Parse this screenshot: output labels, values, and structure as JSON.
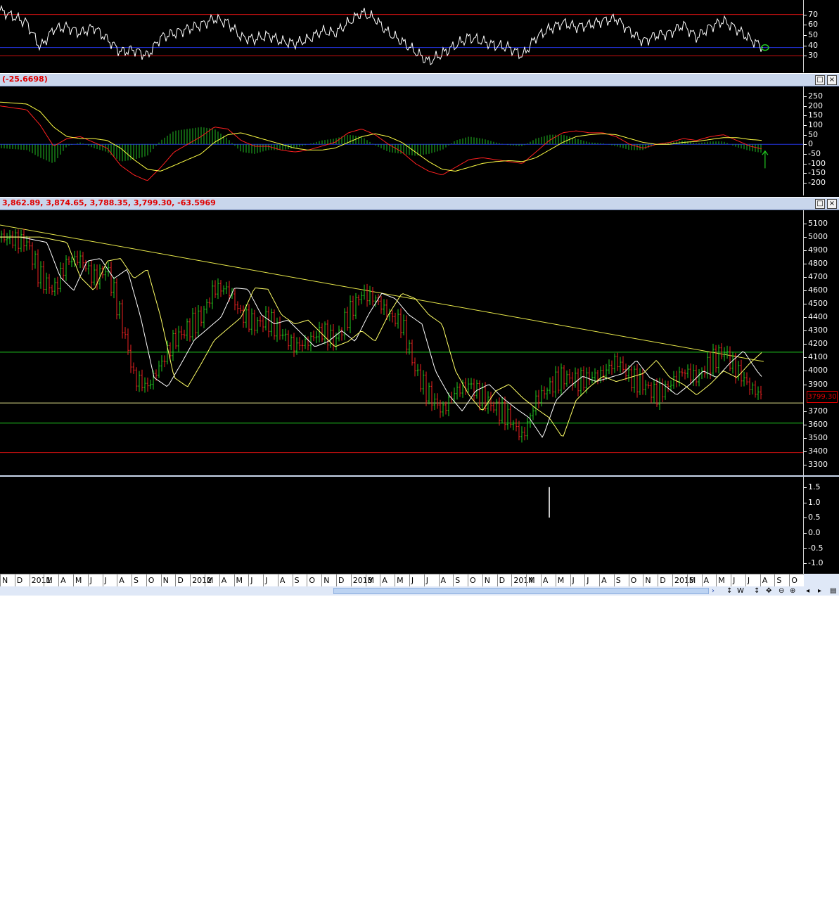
{
  "panes": {
    "rsi": {
      "axis_ticks": [
        "70",
        "60",
        "50",
        "40",
        "30"
      ],
      "tick_values": [
        70,
        60,
        50,
        40,
        30
      ],
      "ylim": [
        18,
        80
      ]
    },
    "macd": {
      "readout": "(-25.6698)",
      "axis_ticks": [
        "250",
        "200",
        "150",
        "100",
        "50",
        "0",
        "-50",
        "-100",
        "-150",
        "-200"
      ],
      "tick_values": [
        250,
        200,
        150,
        100,
        50,
        0,
        -50,
        -100,
        -150,
        -200
      ]
    },
    "price": {
      "readout": "3,862.89, 3,874.65, 3,788.35, 3,799.30, -63.5969",
      "last_price": "3799.30",
      "axis_ticks": [
        "5100",
        "5000",
        "4900",
        "4800",
        "4700",
        "4600",
        "4500",
        "4400",
        "4300",
        "4200",
        "4100",
        "4000",
        "3900",
        "3700",
        "3600",
        "3500",
        "3400",
        "3300"
      ],
      "tick_values": [
        5100,
        5000,
        4900,
        4800,
        4700,
        4600,
        4500,
        4400,
        4300,
        4200,
        4100,
        4000,
        3900,
        3700,
        3600,
        3500,
        3400,
        3300
      ]
    },
    "volume": {
      "axis_ticks": [
        "1.5",
        "1.0",
        "0.5",
        "0.0",
        "-0.5",
        "-1.0"
      ],
      "tick_values": [
        1.5,
        1.0,
        0.5,
        0.0,
        -0.5,
        -1.0
      ]
    }
  },
  "time_axis": [
    "N",
    "D",
    "2011",
    "M",
    "A",
    "M",
    "J",
    "J",
    "A",
    "S",
    "O",
    "N",
    "D",
    "2012",
    "M",
    "A",
    "M",
    "J",
    "J",
    "A",
    "S",
    "O",
    "N",
    "D",
    "2013",
    "M",
    "A",
    "M",
    "J",
    "J",
    "A",
    "S",
    "O",
    "N",
    "D",
    "2014",
    "M",
    "A",
    "M",
    "J",
    "J",
    "A",
    "S",
    "O",
    "N",
    "D",
    "2015",
    "M",
    "A",
    "M",
    "J",
    "J",
    "A",
    "S",
    "O"
  ],
  "controls": [
    "W",
    "↕",
    "✥",
    "⊖",
    "⊕",
    "◂",
    "▸",
    "▤"
  ],
  "window_buttons": {
    "restore": "□",
    "close": "×"
  },
  "colors": {
    "up": "#22cc22",
    "down": "#ee2222",
    "trend": "#e8e84a",
    "ma_fast": "#ffffff",
    "ma_slow": "#ffff66",
    "rsi": "#ffffff",
    "macd": "#ff2020",
    "signal": "#ffff44",
    "hist": "#22bb22",
    "level_red": "#cc1111",
    "level_blue": "#2233dd",
    "level_green": "#22cc22"
  },
  "chart_data": {
    "type": "candlestick",
    "title": "",
    "x_range": [
      "2010-11",
      "2015-10"
    ],
    "price_levels": {
      "resistance": 4140,
      "support_1": 3760,
      "support_2": 3610,
      "support_3": 3390
    },
    "trendline": {
      "from": [
        "2010-11",
        5090
      ],
      "to": [
        "2015-08",
        4070
      ]
    },
    "close_path": [
      [
        "2010-11",
        5000
      ],
      [
        "2011-01",
        4960
      ],
      [
        "2011-02",
        4700
      ],
      [
        "2011-03",
        4600
      ],
      [
        "2011-04",
        4820
      ],
      [
        "2011-05",
        4840
      ],
      [
        "2011-06",
        4690
      ],
      [
        "2011-07",
        4760
      ],
      [
        "2011-08",
        4400
      ],
      [
        "2011-09",
        3950
      ],
      [
        "2011-10",
        3880
      ],
      [
        "2011-11",
        4050
      ],
      [
        "2011-12",
        4230
      ],
      [
        "2012-02",
        4400
      ],
      [
        "2012-03",
        4620
      ],
      [
        "2012-04",
        4610
      ],
      [
        "2012-05",
        4420
      ],
      [
        "2012-06",
        4350
      ],
      [
        "2012-07",
        4380
      ],
      [
        "2012-08",
        4280
      ],
      [
        "2012-09",
        4180
      ],
      [
        "2012-10",
        4220
      ],
      [
        "2012-11",
        4300
      ],
      [
        "2012-12",
        4220
      ],
      [
        "2013-01",
        4420
      ],
      [
        "2013-02",
        4580
      ],
      [
        "2013-03",
        4540
      ],
      [
        "2013-04",
        4420
      ],
      [
        "2013-05",
        4350
      ],
      [
        "2013-06",
        4000
      ],
      [
        "2013-07",
        3820
      ],
      [
        "2013-08",
        3700
      ],
      [
        "2013-09",
        3850
      ],
      [
        "2013-10",
        3900
      ],
      [
        "2013-11",
        3800
      ],
      [
        "2013-12",
        3720
      ],
      [
        "2014-01",
        3650
      ],
      [
        "2014-02",
        3500
      ],
      [
        "2014-03",
        3780
      ],
      [
        "2014-04",
        3880
      ],
      [
        "2014-05",
        3960
      ],
      [
        "2014-06",
        3920
      ],
      [
        "2014-07",
        3950
      ],
      [
        "2014-08",
        3980
      ],
      [
        "2014-09",
        4080
      ],
      [
        "2014-10",
        3950
      ],
      [
        "2014-11",
        3900
      ],
      [
        "2014-12",
        3820
      ],
      [
        "2015-01",
        3900
      ],
      [
        "2015-02",
        4000
      ],
      [
        "2015-03",
        3950
      ],
      [
        "2015-04",
        4060
      ],
      [
        "2015-05",
        4150
      ],
      [
        "2015-06",
        4000
      ],
      [
        "2015-07",
        3880
      ],
      [
        "2015-08",
        3799.3
      ]
    ],
    "last_bar": {
      "open": 3862.89,
      "high": 3874.65,
      "low": 3788.35,
      "close": 3799.3,
      "change": -63.5969
    },
    "rsi": [
      [
        "2010-11",
        74
      ],
      [
        "2011-01",
        62
      ],
      [
        "2011-02",
        38
      ],
      [
        "2011-03",
        56
      ],
      [
        "2011-04",
        58
      ],
      [
        "2011-05",
        52
      ],
      [
        "2011-06",
        58
      ],
      [
        "2011-07",
        46
      ],
      [
        "2011-08",
        34
      ],
      [
        "2011-09",
        36
      ],
      [
        "2011-10",
        30
      ],
      [
        "2011-11",
        48
      ],
      [
        "2011-12",
        52
      ],
      [
        "2012-02",
        60
      ],
      [
        "2012-03",
        66
      ],
      [
        "2012-04",
        62
      ],
      [
        "2012-05",
        48
      ],
      [
        "2012-06",
        46
      ],
      [
        "2012-07",
        50
      ],
      [
        "2012-08",
        44
      ],
      [
        "2012-09",
        42
      ],
      [
        "2012-10",
        46
      ],
      [
        "2012-11",
        54
      ],
      [
        "2012-12",
        52
      ],
      [
        "2013-01",
        62
      ],
      [
        "2013-02",
        72
      ],
      [
        "2013-03",
        66
      ],
      [
        "2013-04",
        52
      ],
      [
        "2013-05",
        44
      ],
      [
        "2013-06",
        34
      ],
      [
        "2013-07",
        24
      ],
      [
        "2013-08",
        32
      ],
      [
        "2013-09",
        40
      ],
      [
        "2013-10",
        48
      ],
      [
        "2013-11",
        44
      ],
      [
        "2013-12",
        40
      ],
      [
        "2014-01",
        38
      ],
      [
        "2014-02",
        30
      ],
      [
        "2014-03",
        48
      ],
      [
        "2014-04",
        56
      ],
      [
        "2014-05",
        62
      ],
      [
        "2014-06",
        58
      ],
      [
        "2014-07",
        60
      ],
      [
        "2014-08",
        64
      ],
      [
        "2014-09",
        66
      ],
      [
        "2014-10",
        54
      ],
      [
        "2014-11",
        44
      ],
      [
        "2014-12",
        50
      ],
      [
        "2015-01",
        52
      ],
      [
        "2015-02",
        60
      ],
      [
        "2015-03",
        48
      ],
      [
        "2015-04",
        58
      ],
      [
        "2015-05",
        64
      ],
      [
        "2015-06",
        56
      ],
      [
        "2015-07",
        46
      ],
      [
        "2015-08",
        38
      ]
    ],
    "macd": [
      [
        "2010-11",
        200
      ],
      [
        "2011-01",
        180
      ],
      [
        "2011-02",
        100
      ],
      [
        "2011-03",
        -10
      ],
      [
        "2011-04",
        30
      ],
      [
        "2011-05",
        40
      ],
      [
        "2011-06",
        10
      ],
      [
        "2011-07",
        -20
      ],
      [
        "2011-08",
        -110
      ],
      [
        "2011-09",
        -160
      ],
      [
        "2011-10",
        -190
      ],
      [
        "2011-11",
        -120
      ],
      [
        "2011-12",
        -40
      ],
      [
        "2012-02",
        40
      ],
      [
        "2012-03",
        90
      ],
      [
        "2012-04",
        80
      ],
      [
        "2012-05",
        20
      ],
      [
        "2012-06",
        -10
      ],
      [
        "2012-07",
        -10
      ],
      [
        "2012-08",
        -30
      ],
      [
        "2012-09",
        -40
      ],
      [
        "2012-10",
        -30
      ],
      [
        "2012-11",
        -10
      ],
      [
        "2012-12",
        10
      ],
      [
        "2013-01",
        60
      ],
      [
        "2013-02",
        80
      ],
      [
        "2013-03",
        50
      ],
      [
        "2013-04",
        0
      ],
      [
        "2013-05",
        -40
      ],
      [
        "2013-06",
        -100
      ],
      [
        "2013-07",
        -140
      ],
      [
        "2013-08",
        -160
      ],
      [
        "2013-09",
        -120
      ],
      [
        "2013-10",
        -80
      ],
      [
        "2013-11",
        -70
      ],
      [
        "2013-12",
        -80
      ],
      [
        "2014-01",
        -90
      ],
      [
        "2014-02",
        -100
      ],
      [
        "2014-03",
        -40
      ],
      [
        "2014-04",
        20
      ],
      [
        "2014-05",
        60
      ],
      [
        "2014-06",
        70
      ],
      [
        "2014-07",
        60
      ],
      [
        "2014-08",
        60
      ],
      [
        "2014-09",
        40
      ],
      [
        "2014-10",
        0
      ],
      [
        "2014-11",
        -20
      ],
      [
        "2014-12",
        0
      ],
      [
        "2015-01",
        10
      ],
      [
        "2015-02",
        30
      ],
      [
        "2015-03",
        20
      ],
      [
        "2015-04",
        40
      ],
      [
        "2015-05",
        50
      ],
      [
        "2015-06",
        20
      ],
      [
        "2015-07",
        -10
      ],
      [
        "2015-08",
        -26
      ]
    ],
    "signal": [
      [
        "2010-11",
        220
      ],
      [
        "2011-01",
        210
      ],
      [
        "2011-02",
        170
      ],
      [
        "2011-03",
        90
      ],
      [
        "2011-04",
        40
      ],
      [
        "2011-05",
        30
      ],
      [
        "2011-06",
        30
      ],
      [
        "2011-07",
        20
      ],
      [
        "2011-08",
        -20
      ],
      [
        "2011-09",
        -80
      ],
      [
        "2011-10",
        -130
      ],
      [
        "2011-11",
        -140
      ],
      [
        "2011-12",
        -110
      ],
      [
        "2012-02",
        -50
      ],
      [
        "2012-03",
        10
      ],
      [
        "2012-04",
        50
      ],
      [
        "2012-05",
        60
      ],
      [
        "2012-06",
        40
      ],
      [
        "2012-07",
        20
      ],
      [
        "2012-08",
        0
      ],
      [
        "2012-09",
        -20
      ],
      [
        "2012-10",
        -30
      ],
      [
        "2012-11",
        -30
      ],
      [
        "2012-12",
        -20
      ],
      [
        "2013-01",
        10
      ],
      [
        "2013-02",
        40
      ],
      [
        "2013-03",
        55
      ],
      [
        "2013-04",
        40
      ],
      [
        "2013-05",
        10
      ],
      [
        "2013-06",
        -40
      ],
      [
        "2013-07",
        -90
      ],
      [
        "2013-08",
        -130
      ],
      [
        "2013-09",
        -140
      ],
      [
        "2013-10",
        -120
      ],
      [
        "2013-11",
        -100
      ],
      [
        "2013-12",
        -90
      ],
      [
        "2014-01",
        -85
      ],
      [
        "2014-02",
        -90
      ],
      [
        "2014-03",
        -70
      ],
      [
        "2014-04",
        -30
      ],
      [
        "2014-05",
        10
      ],
      [
        "2014-06",
        40
      ],
      [
        "2014-07",
        50
      ],
      [
        "2014-08",
        55
      ],
      [
        "2014-09",
        50
      ],
      [
        "2014-10",
        30
      ],
      [
        "2014-11",
        10
      ],
      [
        "2014-12",
        0
      ],
      [
        "2015-01",
        0
      ],
      [
        "2015-02",
        10
      ],
      [
        "2015-03",
        15
      ],
      [
        "2015-04",
        25
      ],
      [
        "2015-05",
        35
      ],
      [
        "2015-06",
        35
      ],
      [
        "2015-07",
        25
      ],
      [
        "2015-08",
        20
      ]
    ],
    "volume_event": {
      "x": "2014-04",
      "value": 1.5
    }
  }
}
